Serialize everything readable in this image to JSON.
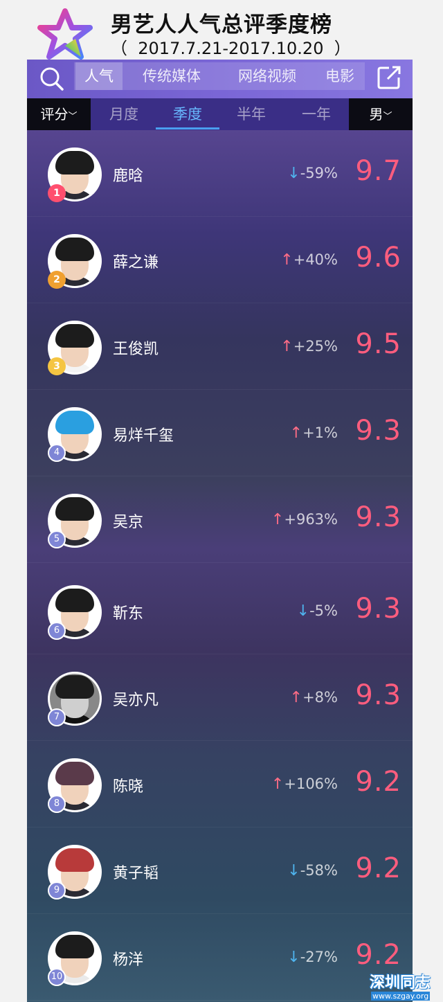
{
  "header": {
    "title": "男艺人人气总评季度榜",
    "subtitle": "（  2017.7.21-2017.10.20  ）"
  },
  "topbar": {
    "tabs": [
      {
        "label": "人气",
        "active": true
      },
      {
        "label": "传统媒体",
        "active": false
      },
      {
        "label": "网络视频",
        "active": false
      },
      {
        "label": "电影",
        "active": false
      }
    ]
  },
  "filterbar": {
    "sort_label": "评分",
    "periods": [
      {
        "label": "月度",
        "active": false
      },
      {
        "label": "季度",
        "active": true
      },
      {
        "label": "半年",
        "active": false
      },
      {
        "label": "一年",
        "active": false
      }
    ],
    "gender_label": "男"
  },
  "ranking": [
    {
      "rank": "1",
      "name": "鹿晗",
      "direction": "down",
      "change": "-59%",
      "score": "9.7"
    },
    {
      "rank": "2",
      "name": "薛之谦",
      "direction": "up",
      "change": "+40%",
      "score": "9.6"
    },
    {
      "rank": "3",
      "name": "王俊凯",
      "direction": "up",
      "change": "+25%",
      "score": "9.5"
    },
    {
      "rank": "4",
      "name": "易烊千玺",
      "direction": "up",
      "change": "+1%",
      "score": "9.3"
    },
    {
      "rank": "5",
      "name": "吴京",
      "direction": "up",
      "change": "+963%",
      "score": "9.3"
    },
    {
      "rank": "6",
      "name": "靳东",
      "direction": "down",
      "change": "-5%",
      "score": "9.3"
    },
    {
      "rank": "7",
      "name": "吴亦凡",
      "direction": "up",
      "change": "+8%",
      "score": "9.3"
    },
    {
      "rank": "8",
      "name": "陈晓",
      "direction": "up",
      "change": "+106%",
      "score": "9.2"
    },
    {
      "rank": "9",
      "name": "黄子韬",
      "direction": "down",
      "change": "-58%",
      "score": "9.2"
    },
    {
      "rank": "10",
      "name": "杨洋",
      "direction": "down",
      "change": "-27%",
      "score": "9.2"
    }
  ],
  "watermark": {
    "big": "深圳同志",
    "small": "www.szgay.org"
  },
  "colors": {
    "accent_purple": "#7a66d6",
    "score_pink": "#ff5d7e",
    "up_arrow": "#ff6d86",
    "down_arrow": "#4fb4ee",
    "active_filter": "#68b9ff",
    "gold_badge": "#f5c542",
    "silver_badge": "#f0a030",
    "first_badge": "#ff4f6e"
  },
  "icons": {
    "search": "search-icon",
    "share": "share-icon",
    "logo": "star-logo-icon"
  }
}
